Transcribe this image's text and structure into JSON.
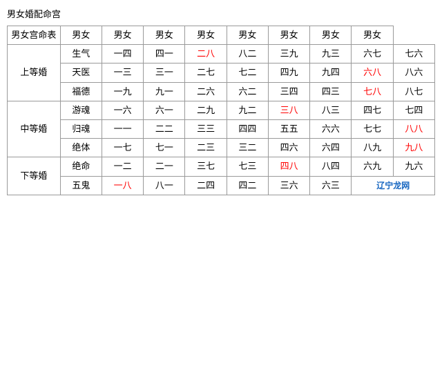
{
  "title": "男女婚配命宫",
  "table": {
    "header": {
      "col0": "男女宫命表",
      "cols": [
        "男女",
        "男女",
        "男女",
        "男女",
        "男女",
        "男女",
        "男女",
        "男女"
      ]
    },
    "groups": [
      {
        "groupLabel": "上等婚",
        "rows": [
          {
            "subLabel": "生气",
            "cells": [
              {
                "text": "一四",
                "red": false
              },
              {
                "text": "四一",
                "red": false
              },
              {
                "text": "二八",
                "red": true
              },
              {
                "text": "八二",
                "red": false
              },
              {
                "text": "三九",
                "red": false
              },
              {
                "text": "九三",
                "red": false
              },
              {
                "text": "六七",
                "red": false
              },
              {
                "text": "七六",
                "red": false
              }
            ]
          },
          {
            "subLabel": "天医",
            "cells": [
              {
                "text": "一三",
                "red": false
              },
              {
                "text": "三一",
                "red": false
              },
              {
                "text": "二七",
                "red": false
              },
              {
                "text": "七二",
                "red": false
              },
              {
                "text": "四九",
                "red": false
              },
              {
                "text": "九四",
                "red": false
              },
              {
                "text": "六八",
                "red": true
              },
              {
                "text": "八六",
                "red": false
              }
            ]
          },
          {
            "subLabel": "福德",
            "cells": [
              {
                "text": "一九",
                "red": false
              },
              {
                "text": "九一",
                "red": false
              },
              {
                "text": "二六",
                "red": false
              },
              {
                "text": "六二",
                "red": false
              },
              {
                "text": "三四",
                "red": false
              },
              {
                "text": "四三",
                "red": false
              },
              {
                "text": "七八",
                "red": true
              },
              {
                "text": "八七",
                "red": false
              }
            ]
          }
        ]
      },
      {
        "groupLabel": "中等婚",
        "rows": [
          {
            "subLabel": "游魂",
            "cells": [
              {
                "text": "一六",
                "red": false
              },
              {
                "text": "六一",
                "red": false
              },
              {
                "text": "二九",
                "red": false
              },
              {
                "text": "九二",
                "red": false
              },
              {
                "text": "三八",
                "red": true
              },
              {
                "text": "八三",
                "red": false
              },
              {
                "text": "四七",
                "red": false
              },
              {
                "text": "七四",
                "red": false
              }
            ]
          },
          {
            "subLabel": "归魂",
            "cells": [
              {
                "text": "一一",
                "red": false
              },
              {
                "text": "二二",
                "red": false
              },
              {
                "text": "三三",
                "red": false
              },
              {
                "text": "四四",
                "red": false
              },
              {
                "text": "五五",
                "red": false
              },
              {
                "text": "六六",
                "red": false
              },
              {
                "text": "七七",
                "red": false
              },
              {
                "text": "八八",
                "red": true
              }
            ]
          },
          {
            "subLabel": "绝体",
            "cells": [
              {
                "text": "一七",
                "red": false
              },
              {
                "text": "七一",
                "red": false
              },
              {
                "text": "二三",
                "red": false
              },
              {
                "text": "三二",
                "red": false
              },
              {
                "text": "四六",
                "red": false
              },
              {
                "text": "六四",
                "red": false
              },
              {
                "text": "八九",
                "red": false
              },
              {
                "text": "九八",
                "red": true
              }
            ]
          }
        ]
      },
      {
        "groupLabel": "下等婚",
        "rows": [
          {
            "subLabel": "绝命",
            "cells": [
              {
                "text": "一二",
                "red": false
              },
              {
                "text": "二一",
                "red": false
              },
              {
                "text": "三七",
                "red": false
              },
              {
                "text": "七三",
                "red": false
              },
              {
                "text": "四八",
                "red": true
              },
              {
                "text": "八四",
                "red": false
              },
              {
                "text": "六九",
                "red": false
              },
              {
                "text": "九六",
                "red": false
              }
            ]
          },
          {
            "subLabel": "五鬼",
            "cells": [
              {
                "text": "一八",
                "red": true
              },
              {
                "text": "八一",
                "red": false
              },
              {
                "text": "二四",
                "red": false
              },
              {
                "text": "四二",
                "red": false
              },
              {
                "text": "三六",
                "red": false
              },
              {
                "text": "六三",
                "red": false
              },
              {
                "text": "watermark",
                "red": false
              },
              {
                "text": "",
                "red": false
              }
            ]
          }
        ]
      }
    ]
  },
  "watermark": "辽宁龙网"
}
